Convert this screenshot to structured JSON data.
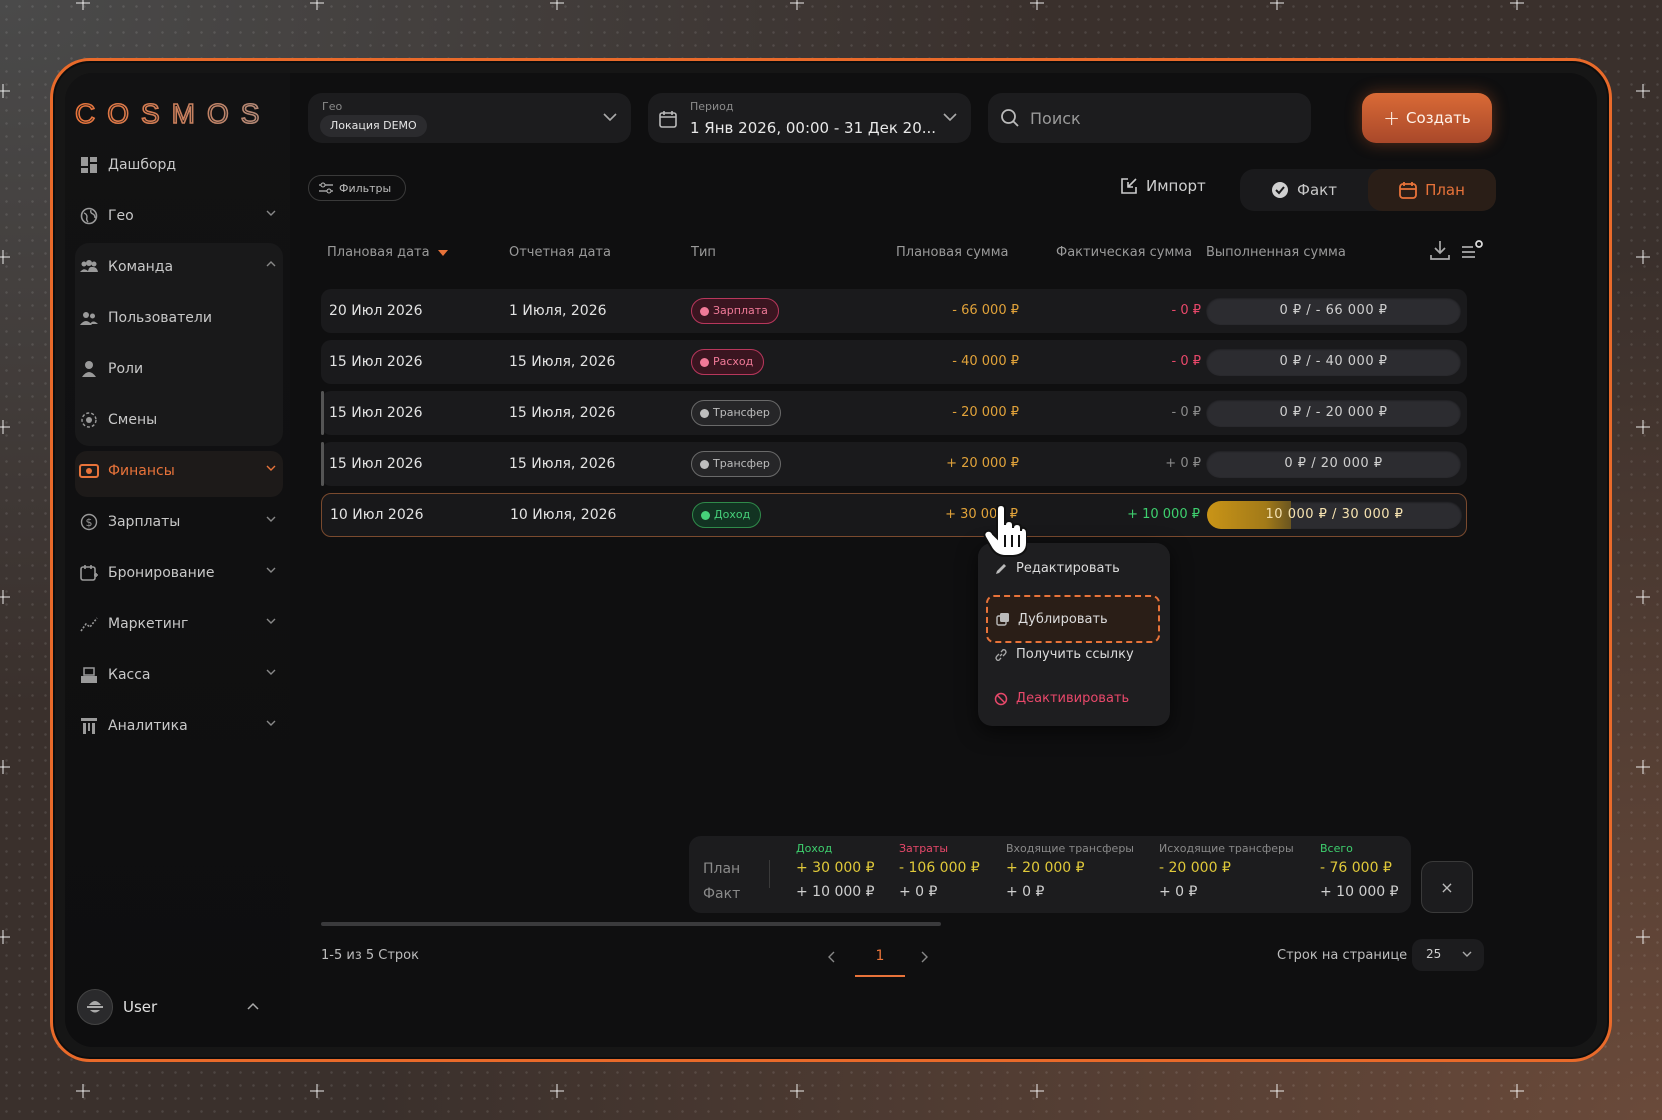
{
  "app": {
    "logo": "COSMOS"
  },
  "sidebar": {
    "items": [
      {
        "label": "Дашборд",
        "icon": "dashboard-icon"
      },
      {
        "label": "Гео",
        "icon": "globe-icon"
      },
      {
        "label": "Команда",
        "icon": "team-icon"
      },
      {
        "label": "Пользователи",
        "icon": "users-icon"
      },
      {
        "label": "Роли",
        "icon": "person-icon"
      },
      {
        "label": "Смены",
        "icon": "shift-icon"
      },
      {
        "label": "Финансы",
        "icon": "finance-icon"
      },
      {
        "label": "Зарплаты",
        "icon": "dollar-icon"
      },
      {
        "label": "Бронирование",
        "icon": "calendar-plus-icon"
      },
      {
        "label": "Маркетинг",
        "icon": "chart-icon"
      },
      {
        "label": "Касса",
        "icon": "cashbox-icon"
      },
      {
        "label": "Аналитика",
        "icon": "analytics-icon"
      }
    ],
    "user": {
      "name": "User"
    }
  },
  "header": {
    "geo": {
      "label": "Гео",
      "value": "Локация DEMO"
    },
    "period": {
      "label": "Период",
      "value": "1 Янв 2026, 00:00 - 31 Дек 20..."
    },
    "search": {
      "placeholder": "Поиск"
    },
    "create_label": "Создать"
  },
  "toolbar": {
    "filters_label": "Фильтры",
    "import_label": "Импорт",
    "segments": {
      "fact": "Факт",
      "plan": "План"
    }
  },
  "table": {
    "columns": {
      "plan_date": "Плановая дата",
      "report_date": "Отчетная дата",
      "type": "Тип",
      "plan_sum": "Плановая сумма",
      "fact_sum": "Фактическая сумма",
      "done_sum": "Выполненная сумма"
    },
    "rows": [
      {
        "plan_date": "20 Июл 2026",
        "report_date": "1 Июля, 2026",
        "type": "Зарплата",
        "plan_sum": "- 66 000 ₽",
        "fact_sum": "- 0 ₽",
        "done": "0 ₽ / - 66 000 ₽",
        "progress": 0
      },
      {
        "plan_date": "15 Июл 2026",
        "report_date": "15 Июля, 2026",
        "type": "Расход",
        "plan_sum": "- 40 000 ₽",
        "fact_sum": "- 0 ₽",
        "done": "0 ₽ / - 40 000 ₽",
        "progress": 0
      },
      {
        "plan_date": "15 Июл 2026",
        "report_date": "15 Июля, 2026",
        "type": "Трансфер",
        "plan_sum": "- 20 000 ₽",
        "fact_sum": "- 0 ₽",
        "done": "0 ₽ / - 20 000 ₽",
        "progress": 0
      },
      {
        "plan_date": "15 Июл 2026",
        "report_date": "15 Июля, 2026",
        "type": "Трансфер",
        "plan_sum": "+ 20 000 ₽",
        "fact_sum": "+ 0 ₽",
        "done": "0 ₽ / 20 000 ₽",
        "progress": 0
      },
      {
        "plan_date": "10 Июл 2026",
        "report_date": "10 Июля, 2026",
        "type": "Доход",
        "plan_sum": "+ 30 000 ₽",
        "fact_sum": "+ 10 000 ₽",
        "done": "10 000 ₽ / 30 000 ₽",
        "progress": 0.33
      }
    ]
  },
  "context_menu": {
    "edit": "Редактировать",
    "duplicate": "Дублировать",
    "get_link": "Получить ссылку",
    "deactivate": "Деактивировать"
  },
  "summary": {
    "row_plan": "План",
    "row_fact": "Факт",
    "columns": [
      {
        "title": "Доход",
        "plan": "+ 30 000 ₽",
        "fact": "+ 10 000 ₽"
      },
      {
        "title": "Затраты",
        "plan": "- 106 000 ₽",
        "fact": "+ 0 ₽"
      },
      {
        "title": "Входящие трансферы",
        "plan": "+ 20 000 ₽",
        "fact": "+ 0 ₽"
      },
      {
        "title": "Исходящие трансферы",
        "plan": "- 20 000 ₽",
        "fact": "+ 0 ₽"
      },
      {
        "title": "Всего",
        "plan": "- 76 000 ₽",
        "fact": "+ 10 000 ₽"
      }
    ],
    "close_label": "×"
  },
  "footer": {
    "count": "1-5 из 5 Строк",
    "page": "1",
    "rows_per_page_label": "Строк на странице",
    "rows_per_page": "25"
  },
  "colors": {
    "accent": "#e8733a",
    "positive": "#3ecf6e",
    "negative": "#e8486a",
    "plan_amount": "#e0a23a"
  }
}
